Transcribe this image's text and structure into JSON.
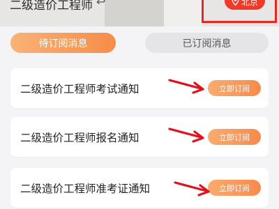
{
  "header": {
    "title": "二级造价工程师",
    "back_glyph": "↩",
    "city_label": "北京",
    "pin_icon": "location-pin-icon"
  },
  "tabs": [
    {
      "label": "待订阅消息",
      "active": true
    },
    {
      "label": "已订阅消息",
      "active": false
    }
  ],
  "notices": [
    {
      "title": "二级造价工程师考试通知",
      "button_label": "立即订阅"
    },
    {
      "title": "二级造价工程师报名通知",
      "button_label": "立即订阅"
    },
    {
      "title": "二级造价工程师准考证通知",
      "button_label": "立即订阅"
    }
  ],
  "colors": {
    "accent_orange": "#f78c48",
    "highlight_red": "#e8281f",
    "annotation_arrow": "#e1121b"
  }
}
